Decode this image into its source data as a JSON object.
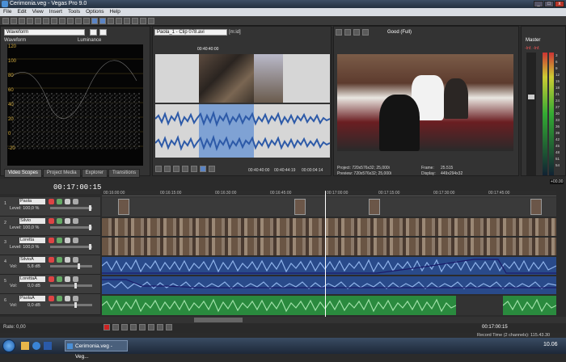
{
  "window": {
    "title": "Cerimonia.veg - Vegas Pro 9.0"
  },
  "menu": [
    "File",
    "Edit",
    "View",
    "Insert",
    "Tools",
    "Options",
    "Help"
  ],
  "scopes": {
    "mode": "Waveform",
    "channel": "Luminance",
    "labels": [
      "120",
      "100",
      "80",
      "60",
      "40",
      "20",
      "0",
      "-20"
    ]
  },
  "left_tabs": [
    "Video Scopes",
    "Project Media",
    "Explorer",
    "Transitions"
  ],
  "trimmer": {
    "clip": "Paola_1 - Clip 078.avi",
    "icon_text": "[m:id]",
    "timecode": "00:40:40:00",
    "readouts": [
      "00:40:40:00",
      "00:40:44:19",
      "00:00:04:14"
    ]
  },
  "preview": {
    "quality": "Good (Full)",
    "project": "Project: 720x576x32; 25,000i",
    "preview": "Preview: 720x576x32; 25,000i",
    "frame_label": "Frame:",
    "frame": "25.515",
    "display_label": "Display:",
    "display": "449x294x32"
  },
  "master": {
    "label": "Master",
    "readout": "-Inf.  -Inf.",
    "scale": [
      "3",
      "6",
      "9",
      "12",
      "15",
      "18",
      "21",
      "24",
      "27",
      "30",
      "33",
      "36",
      "39",
      "42",
      "45",
      "48",
      "51",
      "54",
      "57"
    ],
    "value": "+00.00"
  },
  "timeline": {
    "cursor": "00:17:00:15",
    "ruler": [
      "00:16:00:00",
      "00:16:15:00",
      "00:16:30:00",
      "00:16:45:00",
      "00:17:00:00",
      "00:17:15:00",
      "00:17:30:00",
      "00:17:45:00"
    ]
  },
  "tracks": [
    {
      "num": "1",
      "name": "Paola",
      "level": "Level: 100,0 %"
    },
    {
      "num": "2",
      "name": "Silvio",
      "level": "Level: 100,0 %"
    },
    {
      "num": "3",
      "name": "Loretta",
      "level": "Level: 100,0 %"
    },
    {
      "num": "4",
      "name": "SilvioA",
      "level": "5,8 dB",
      "vol": "Vol:"
    },
    {
      "num": "5",
      "name": "LorettaA",
      "level": "0,0 dB",
      "vol": "Vol:"
    },
    {
      "num": "6",
      "name": "PaolaA",
      "level": "0,0 dB",
      "vol": "Vol:"
    }
  ],
  "status": {
    "rate": "Rate: 0,00",
    "time": "00:17:00:15",
    "record": "Record Time (2 channels): 115.43.30"
  },
  "taskbar": {
    "app": "Cerimonia.veg - Veg...",
    "clock": "10.06"
  }
}
